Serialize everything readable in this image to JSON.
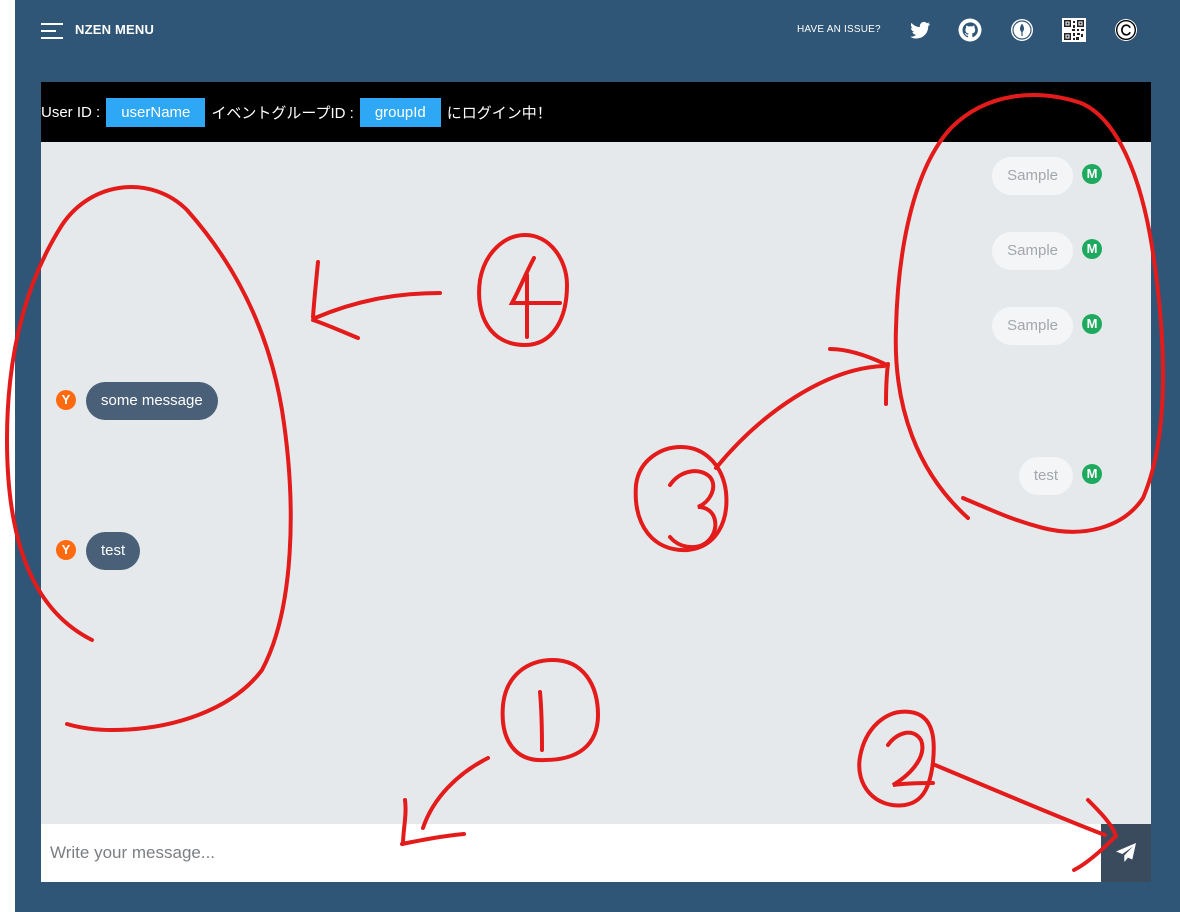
{
  "nav": {
    "menu_title": "NZEN MENU",
    "issue_link": "HAVE AN ISSUE?",
    "icons": [
      "twitter-icon",
      "github-icon",
      "badge-icon",
      "qr-code-icon",
      "copyright-icon"
    ]
  },
  "login": {
    "user_label": "User ID :",
    "user_id": "userName",
    "group_label": "イベントグループID :",
    "group_id": "groupId",
    "suffix": "にログイン中！"
  },
  "messages": {
    "mine": [
      {
        "text": "Sample",
        "avatar": "M"
      },
      {
        "text": "Sample",
        "avatar": "M"
      },
      {
        "text": "Sample",
        "avatar": "M"
      },
      {
        "text": "test",
        "avatar": "M"
      }
    ],
    "others": [
      {
        "text": "some message",
        "avatar": "Y"
      },
      {
        "text": "test",
        "avatar": "Y"
      }
    ]
  },
  "composer": {
    "placeholder": "Write your message..."
  },
  "annotations": [
    "①",
    "②",
    "③",
    "④"
  ],
  "colors": {
    "background": "#2f5577",
    "chat_area": "#e6e9eb",
    "login_bar": "#000000",
    "chip": "#2ea8f5",
    "mine_avatar": "#1eaa5e",
    "other_avatar": "#ff6a10",
    "other_bubble": "#4a6079",
    "annotation": "#e31b1b"
  }
}
